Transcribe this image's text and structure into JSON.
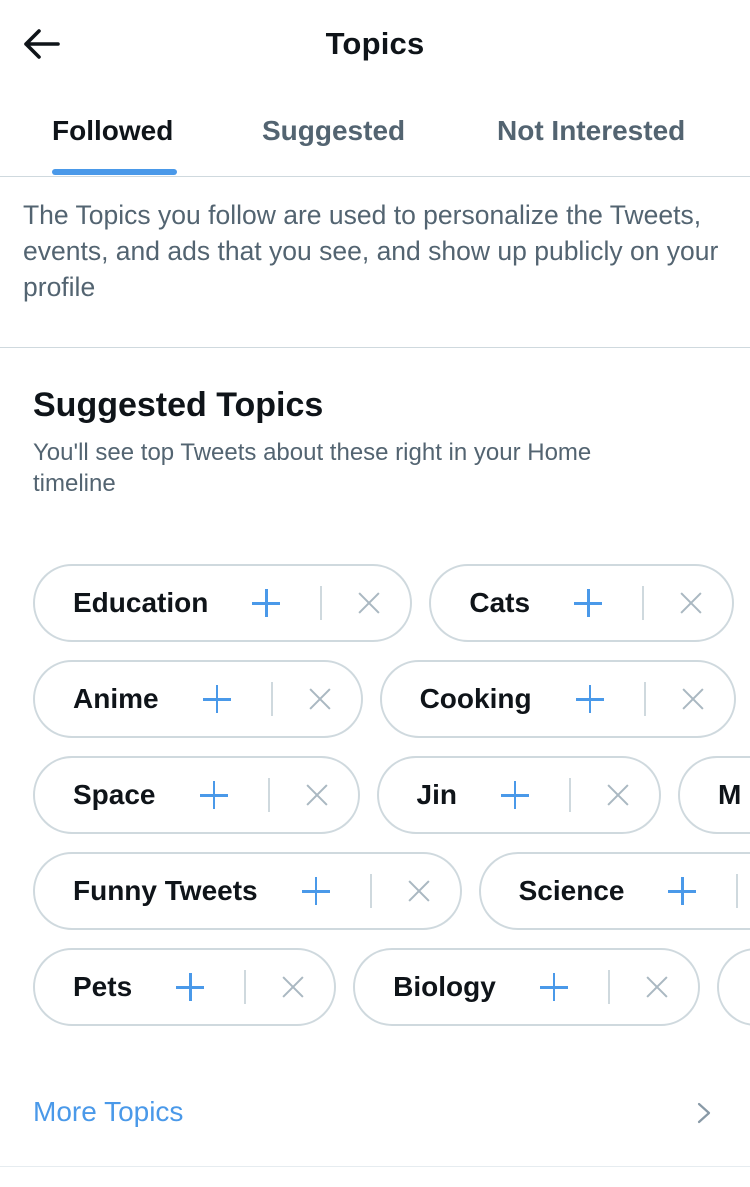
{
  "header": {
    "title": "Topics",
    "back_icon": "arrow-left-icon"
  },
  "tabs": [
    {
      "label": "Followed",
      "active": true
    },
    {
      "label": "Suggested",
      "active": false
    },
    {
      "label": "Not Interested",
      "active": false
    }
  ],
  "description": "The Topics you follow are used to personalize the Tweets, events, and ads that you see, and show up publicly on your profile",
  "suggested": {
    "title": "Suggested Topics",
    "subtitle": "You'll see top Tweets about these right in your Home timeline",
    "rows": [
      [
        {
          "label": "Education"
        },
        {
          "label": "Cats"
        }
      ],
      [
        {
          "label": "Anime"
        },
        {
          "label": "Cooking"
        }
      ],
      [
        {
          "label": "Space"
        },
        {
          "label": "Jin"
        },
        {
          "label": "M"
        }
      ],
      [
        {
          "label": "Funny Tweets"
        },
        {
          "label": "Science"
        }
      ],
      [
        {
          "label": "Pets"
        },
        {
          "label": "Biology"
        },
        {
          "label": ""
        }
      ]
    ]
  },
  "more_topics": {
    "label": "More Topics",
    "icon": "chevron-right-icon"
  },
  "colors": {
    "accent": "#4a99e9",
    "text": "#0f1419",
    "secondary_text": "#536471",
    "border": "#cfd9de"
  }
}
